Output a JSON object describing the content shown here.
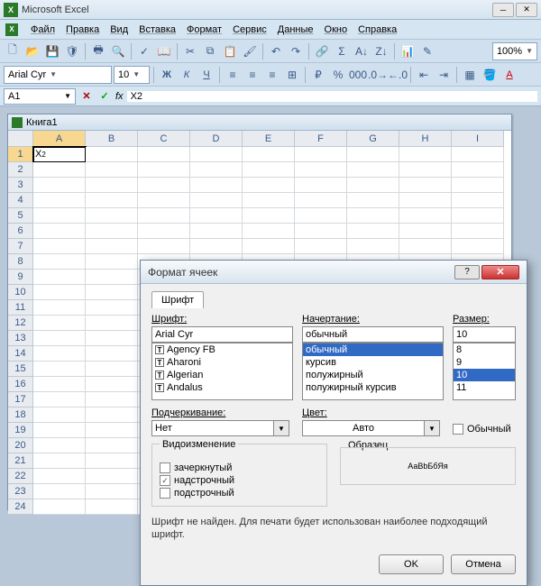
{
  "app": {
    "icon_text": "X",
    "title": "Microsoft Excel",
    "zoom": "100%"
  },
  "menu": {
    "file": "Файл",
    "edit": "Правка",
    "view": "Вид",
    "insert": "Вставка",
    "format": "Формат",
    "tools": "Сервис",
    "data": "Данные",
    "window": "Окно",
    "help": "Справка"
  },
  "fontbar": {
    "fontname": "Arial Cyr",
    "fontsize": "10"
  },
  "formulabar": {
    "namebox": "A1",
    "fx": "fx",
    "formula": "X2"
  },
  "workbook": {
    "title": "Книга1",
    "cols": [
      "A",
      "B",
      "C",
      "D",
      "E",
      "F",
      "G",
      "H",
      "I"
    ],
    "active_cell_value": "X",
    "active_cell_sup": "2"
  },
  "dialog": {
    "title": "Формат ячеек",
    "tab": "Шрифт",
    "font_label": "Шрифт:",
    "font_value": "Arial Cyr",
    "font_list": [
      "Agency FB",
      "Aharoni",
      "Algerian",
      "Andalus"
    ],
    "style_label": "Начертание:",
    "style_value": "обычный",
    "style_list": [
      "обычный",
      "курсив",
      "полужирный",
      "полужирный курсив"
    ],
    "style_selected_index": 0,
    "size_label": "Размер:",
    "size_value": "10",
    "size_list": [
      "8",
      "9",
      "10",
      "11"
    ],
    "size_selected_index": 2,
    "underline_label": "Подчеркивание:",
    "underline_value": "Нет",
    "color_label": "Цвет:",
    "color_value": "Авто",
    "normal_checkbox": "Обычный",
    "effects_label": "Видоизменение",
    "strike": "зачеркнутый",
    "superscript": "надстрочный",
    "subscript": "подстрочный",
    "sample_label": "Образец",
    "sample_text": "АаВbБбЯя",
    "hint": "Шрифт не найден. Для печати будет использован наиболее подходящий шрифт.",
    "ok": "OK",
    "cancel": "Отмена"
  }
}
